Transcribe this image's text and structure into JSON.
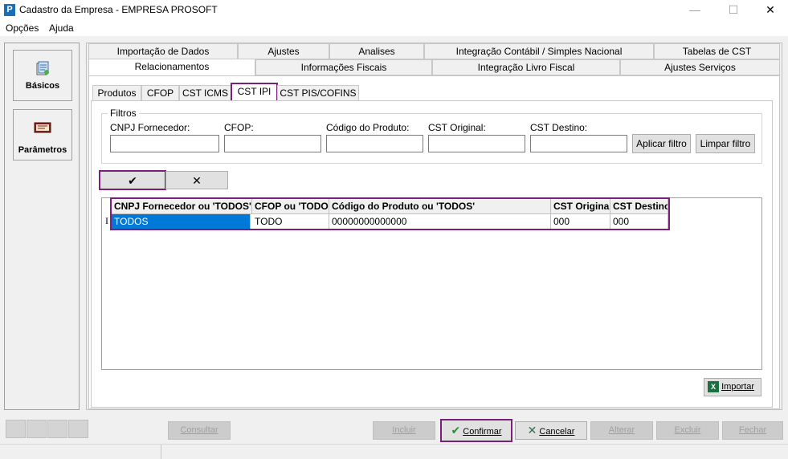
{
  "window": {
    "title": "Cadastro da Empresa - EMPRESA PROSOFT",
    "app_icon": "P",
    "minimize": "—",
    "maximize": "☐",
    "close": "✕"
  },
  "menu": [
    "Opções",
    "Ajuda"
  ],
  "sidebar": {
    "items": [
      {
        "label": "Básicos",
        "icon": "basicos-icon"
      },
      {
        "label": "Parâmetros",
        "icon": "parametros-icon"
      }
    ]
  },
  "tabs": {
    "row1": [
      "Importação de Dados",
      "Ajustes",
      "Analises",
      "Integração Contábil / Simples Nacional",
      "Tabelas de CST"
    ],
    "row2": [
      "Relacionamentos",
      "Informações Fiscais",
      "Integração Livro Fiscal",
      "Ajustes Serviços"
    ],
    "active": "Relacionamentos"
  },
  "subtabs": {
    "items": [
      "Produtos",
      "CFOP",
      "CST ICMS",
      "CST IPI",
      "CST PIS/COFINS"
    ],
    "active": "CST IPI"
  },
  "filters": {
    "legend": "Filtros",
    "labels": [
      "CNPJ Fornecedor:",
      "CFOP:",
      "Código do Produto:",
      "CST Original:",
      "CST Destino:"
    ],
    "values": [
      "",
      "",
      "",
      "",
      ""
    ],
    "apply_label": "Aplicar filtro",
    "clear_label": "Limpar filtro"
  },
  "nav": {
    "confirm_glyph": "✔",
    "cancel_glyph": "✕"
  },
  "grid": {
    "columns": [
      "CNPJ Fornecedor ou 'TODOS'",
      "CFOP ou 'TODO'",
      "Código do Produto ou 'TODOS'",
      "CST Original",
      "CST Destino"
    ],
    "rows": [
      [
        "TODOS",
        "TODO",
        "00000000000000",
        "000",
        "000"
      ]
    ],
    "row_indicator": "I"
  },
  "import": {
    "label": "Importar",
    "icon": "excel-icon"
  },
  "bottom": {
    "consultar": "Consultar",
    "incluir": "Incluir",
    "confirmar": "Confirmar",
    "cancelar": "Cancelar",
    "alterar": "Alterar",
    "excluir": "Excluir",
    "fechar": "Fechar"
  },
  "colors": {
    "highlight": "#7a1f7a",
    "selection": "#0078d7"
  }
}
